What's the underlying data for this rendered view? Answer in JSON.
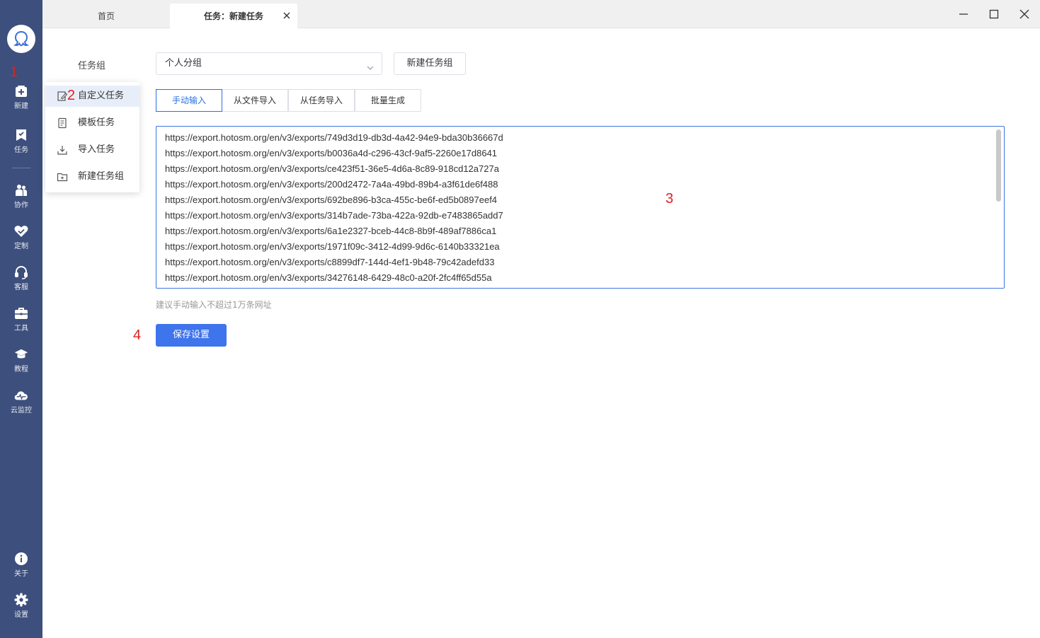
{
  "sidebar": {
    "logo_icon": "octopus-logo-icon",
    "items": [
      {
        "label": "新建",
        "icon": "add-box-icon"
      },
      {
        "label": "任务",
        "icon": "bookmark-flag-icon"
      },
      {
        "label": "协作",
        "icon": "people-icon"
      },
      {
        "label": "定制",
        "icon": "heart-check-icon"
      },
      {
        "label": "客服",
        "icon": "headset-icon"
      },
      {
        "label": "工具",
        "icon": "toolbox-icon"
      },
      {
        "label": "教程",
        "icon": "graduation-cap-icon"
      },
      {
        "label": "云监控",
        "icon": "cloud-monitor-icon"
      }
    ],
    "bottom_items": [
      {
        "label": "关于",
        "icon": "info-icon"
      },
      {
        "label": "设置",
        "icon": "gear-icon"
      }
    ]
  },
  "tabs": {
    "home": "首页",
    "active": "任务：新建任务"
  },
  "menu": {
    "items": [
      {
        "label": "自定义任务",
        "icon": "edit-icon"
      },
      {
        "label": "模板任务",
        "icon": "template-icon"
      },
      {
        "label": "导入任务",
        "icon": "import-icon"
      },
      {
        "label": "新建任务组",
        "icon": "folder-add-icon"
      }
    ]
  },
  "form": {
    "group_label": "任务组",
    "group_value": "个人分组",
    "new_group_button": "新建任务组",
    "input_tabs": [
      "手动输入",
      "从文件导入",
      "从任务导入",
      "批量生成"
    ],
    "urls": [
      "https://export.hotosm.org/en/v3/exports/749d3d19-db3d-4a42-94e9-bda30b36667d",
      "https://export.hotosm.org/en/v3/exports/b0036a4d-c296-43cf-9af5-2260e17d8641",
      "https://export.hotosm.org/en/v3/exports/ce423f51-36e5-4d6a-8c89-918cd12a727a",
      "https://export.hotosm.org/en/v3/exports/200d2472-7a4a-49bd-89b4-a3f61de6f488",
      "https://export.hotosm.org/en/v3/exports/692be896-b3ca-455c-be6f-ed5b0897eef4",
      "https://export.hotosm.org/en/v3/exports/314b7ade-73ba-422a-92db-e7483865add7",
      "https://export.hotosm.org/en/v3/exports/6a1e2327-bceb-44c8-8b9f-489af7886ca1",
      "https://export.hotosm.org/en/v3/exports/1971f09c-3412-4d99-9d6c-6140b33321ea",
      "https://export.hotosm.org/en/v3/exports/c8899df7-144d-4ef1-9b48-79c42adefd33",
      "https://export.hotosm.org/en/v3/exports/34276148-6429-48c0-a20f-2fc4ff65d55a"
    ],
    "hint": "建议手动输入不超过1万条网址",
    "save_button": "保存设置"
  },
  "markers": [
    "1",
    "2",
    "3",
    "4"
  ],
  "colors": {
    "sidebar_bg": "#3d4f7c",
    "accent": "#3e74ec",
    "marker": "#e02020"
  }
}
